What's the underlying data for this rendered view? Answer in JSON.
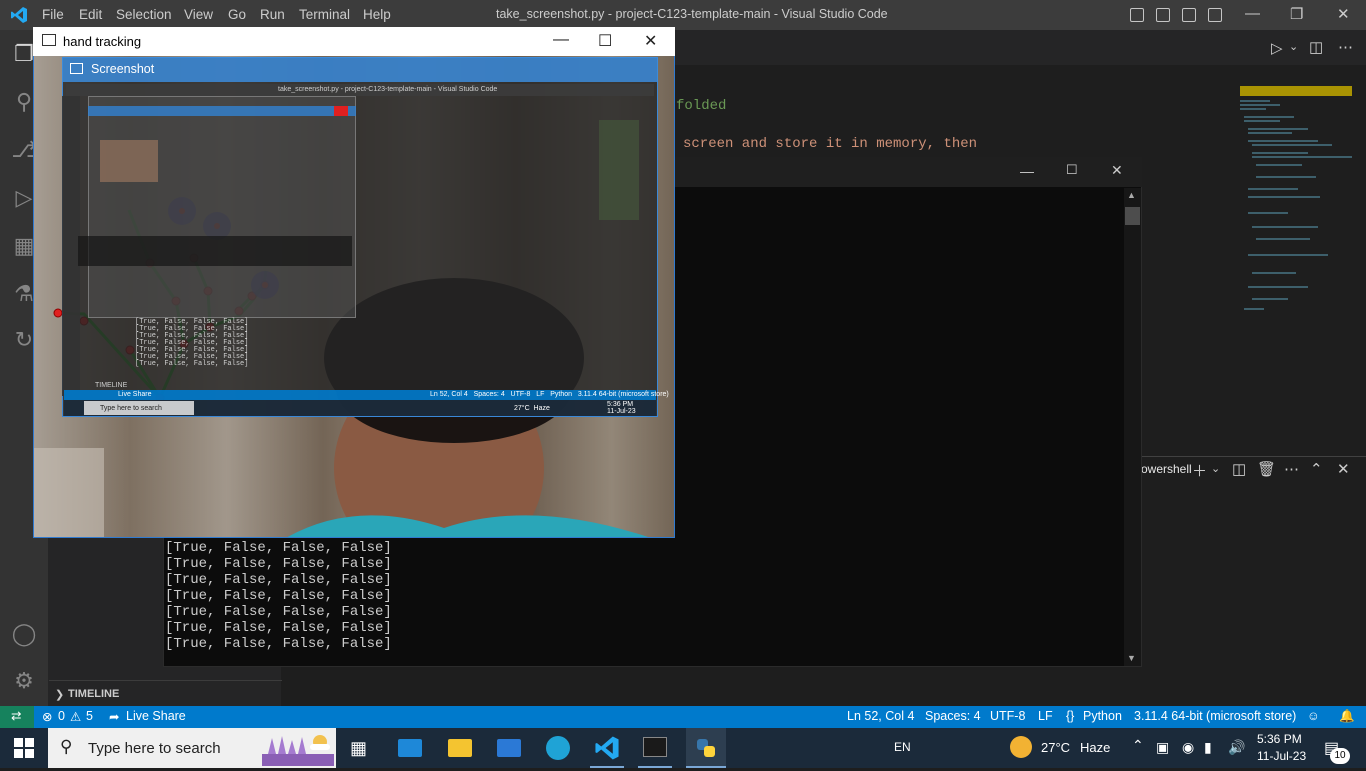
{
  "vscode": {
    "menu": [
      "File",
      "Edit",
      "Selection",
      "View",
      "Go",
      "Run",
      "Terminal",
      "Help"
    ],
    "window_title": "take_screenshot.py - project-C123-template-main - Visual Studio Code",
    "code_lines": [
      "folded",
      "screen and store it in memory, then"
    ],
    "sidebar_section": "TIMELINE",
    "terminal_name": "owershell",
    "status": {
      "errors": "0",
      "warnings": "5",
      "live_share": "Live Share",
      "position": "Ln 52, Col 4",
      "spaces": "Spaces: 4",
      "encoding": "UTF-8",
      "eol": "LF",
      "language": "Python",
      "interpreter": "3.11.4 64-bit (microsoft store)"
    }
  },
  "console": {
    "lines": [
      "[True, False, False, False]",
      "[True, False, False, False]",
      "[True, False, False, False]",
      "[True, False, False, False]",
      "[True, False, False, False]",
      "[True, False, False, False]",
      "[True, False, False, False]"
    ]
  },
  "hand_tracking": {
    "title": "hand tracking",
    "inner_title": "Screenshot",
    "inner_vscode_title": "take_screenshot.py - project-C123-template-main - Visual Studio Code",
    "inner_console_lines": [
      "[True, False, False, False]",
      "[True, False, False, False]",
      "[True, False, False, False]",
      "[True, False, False, False]",
      "[True, False, False, False]",
      "[True, False, False, False]",
      "[True, False, False, False]"
    ],
    "inner_status": "Ln 52, Col 4   Spaces: 4   UTF-8   LF   Python   3.11.4 64-bit (microsoft store)",
    "inner_search": "Type here to search",
    "inner_weather": "27°C  Haze",
    "inner_time": "5:36 PM",
    "inner_date": "11-Jul-23",
    "inner_timeline": "TIMELINE",
    "inner_live_share": "Live Share"
  },
  "taskbar": {
    "search_placeholder": "Type here to search",
    "language": "EN",
    "weather_temp": "27°C",
    "weather_desc": "Haze",
    "time": "5:36 PM",
    "date": "11-Jul-23",
    "notifications": "10"
  },
  "colors": {
    "accent": "#007acc",
    "titlebar": "#3c3c3c",
    "taskbar": "#1b2a3a",
    "landmark": "#e02020",
    "connection": "#2a9d2a",
    "fingertip": "#3a3acb"
  }
}
